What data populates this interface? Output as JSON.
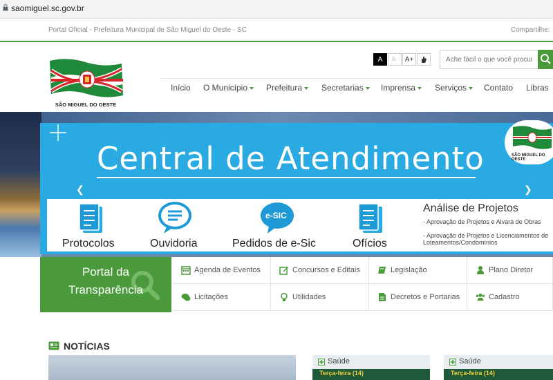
{
  "browser": {
    "url": "saomiguel.sc.gov.br"
  },
  "topbar": {
    "left_text": "Portal Oficial - Prefeitura Municipal de São Miguel do Oeste - SC",
    "share_label": "Compartilhe:"
  },
  "header": {
    "logo_text": "SÃO MIGUEL DO OESTE",
    "accessibility": {
      "contrast": "A",
      "decrease": "A-",
      "increase": "A+"
    },
    "search": {
      "placeholder": "Ache fácil o que você procura"
    }
  },
  "nav": [
    {
      "label": "Início",
      "dropdown": false
    },
    {
      "label": "O Município",
      "dropdown": true
    },
    {
      "label": "Prefeitura",
      "dropdown": true
    },
    {
      "label": "Secretarias",
      "dropdown": true
    },
    {
      "label": "Imprensa",
      "dropdown": true
    },
    {
      "label": "Serviços",
      "dropdown": true
    },
    {
      "label": "Contato",
      "dropdown": false
    },
    {
      "label": "Libras",
      "dropdown": false
    }
  ],
  "banner": {
    "headline": "Central de Atendimento",
    "badge_text": "SÃO MIGUEL DO OESTE",
    "services": [
      {
        "label": "Protocolos"
      },
      {
        "label": "Ouvidoria"
      },
      {
        "label": "Pedidos de e-Sic",
        "icon_text": "e-SIC"
      },
      {
        "label": "Ofícios"
      }
    ],
    "analysis": {
      "title": "Análise de Projetos",
      "line1": "- Aprovação de Projetos e Alvará de Obras",
      "line2": "- Aprovação de Projetos e Licenciamentos de Loteamentos/Condomínios"
    }
  },
  "transparency": {
    "line1": "Portal da",
    "line2": "Transparência"
  },
  "quick_links": [
    {
      "label": "Agenda de Eventos",
      "icon": "calendar-icon"
    },
    {
      "label": "Concursos e Editais",
      "icon": "edit-icon"
    },
    {
      "label": "Legislação",
      "icon": "book-icon"
    },
    {
      "label": "Plano Diretor",
      "icon": "user-icon"
    },
    {
      "label": "Licitações",
      "icon": "chat-icon"
    },
    {
      "label": "Utilidades",
      "icon": "lightbulb-icon"
    },
    {
      "label": "Decretos e Portarias",
      "icon": "document-icon"
    },
    {
      "label": "Cadastro",
      "icon": "users-icon"
    }
  ],
  "news": {
    "title": "NOTÍCIAS",
    "cards": [
      {
        "category": "Saúde",
        "day": "Terça-feira (14)"
      },
      {
        "category": "Saúde",
        "day": "Terça-feira (14)"
      }
    ]
  },
  "colors": {
    "brand_green": "#4a9a3b",
    "banner_blue": "#2aaae2",
    "flag_red": "#d6262b"
  }
}
